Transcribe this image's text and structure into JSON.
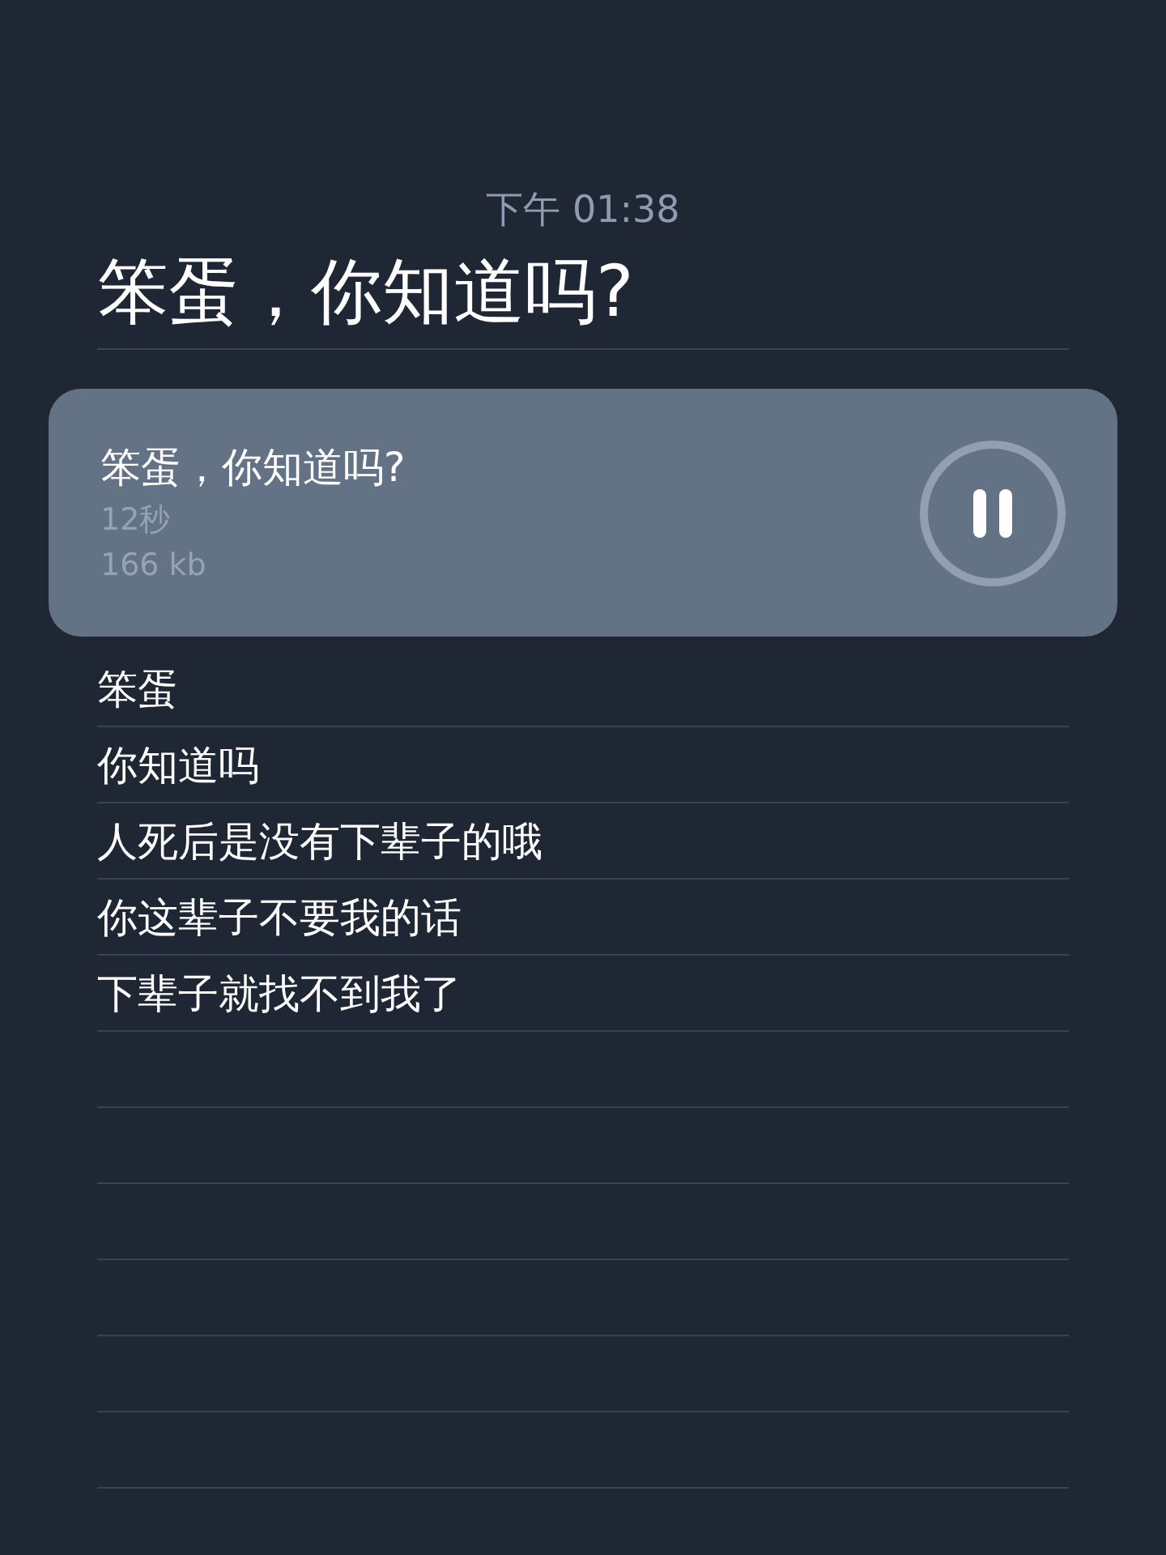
{
  "time": "下午 01:38",
  "title": "笨蛋，你知道吗?",
  "recording": {
    "title": "笨蛋，你知道吗?",
    "duration": "12秒",
    "size": "166 kb",
    "playing": true
  },
  "lines": [
    "笨蛋",
    "你知道吗",
    "人死后是没有下辈子的哦",
    "你这辈子不要我的话",
    "下辈子就找不到我了"
  ]
}
